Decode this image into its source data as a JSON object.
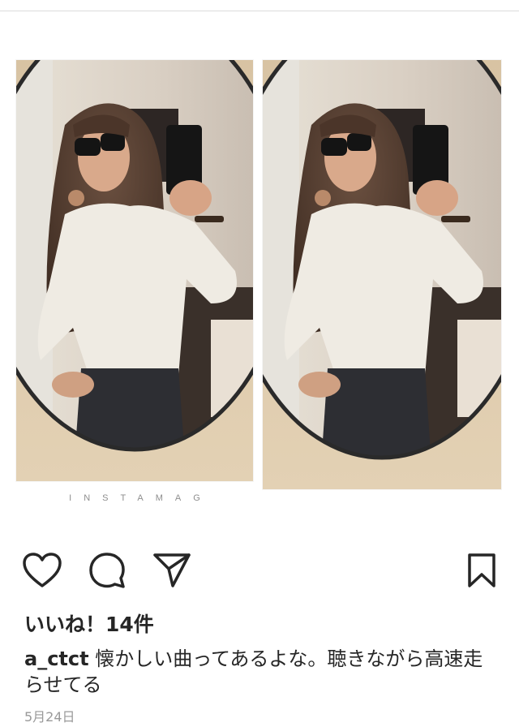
{
  "post": {
    "watermark": "INSTAMAG",
    "likes_text": "いいね！14件",
    "username": "a_ctct",
    "caption": "懐かしい曲ってあるよな。聴きながら高速走らせてる",
    "date": "5月24日"
  },
  "icons": {
    "like": "heart-outline-icon",
    "comment": "comment-bubble-icon",
    "share": "paper-plane-icon",
    "save": "bookmark-icon"
  },
  "colors": {
    "text": "#262626",
    "muted": "#999999",
    "divider": "#dbdbdb"
  }
}
